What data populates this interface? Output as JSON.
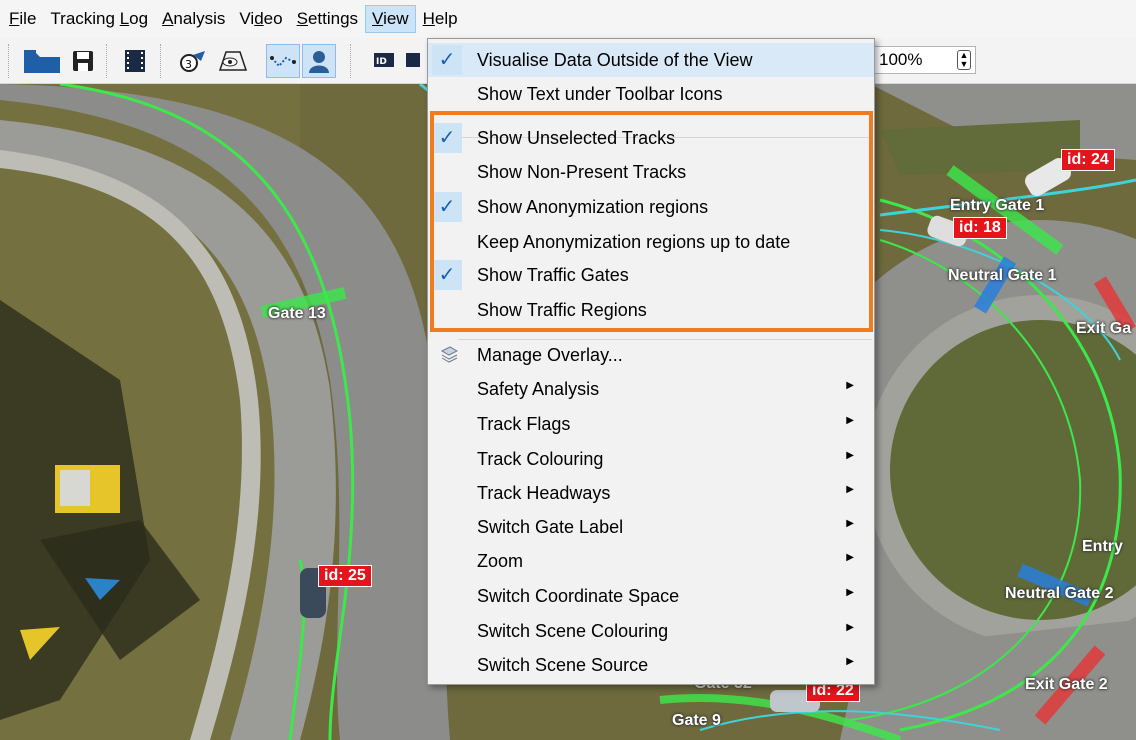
{
  "menubar": {
    "items": [
      {
        "pre": "",
        "acc": "F",
        "post": "ile"
      },
      {
        "pre": "Tracking ",
        "acc": "L",
        "post": "og"
      },
      {
        "pre": "",
        "acc": "A",
        "post": "nalysis"
      },
      {
        "pre": "Vi",
        "acc": "d",
        "post": "eo"
      },
      {
        "pre": "",
        "acc": "S",
        "post": "ettings"
      },
      {
        "pre": "",
        "acc": "V",
        "post": "iew"
      },
      {
        "pre": "",
        "acc": "H",
        "post": "elp"
      }
    ]
  },
  "toolbar": {
    "zoom_value": "100%",
    "icons": [
      "folder-icon",
      "save-icon",
      "film-icon",
      "timer-pointer-icon",
      "eye-region-icon",
      "track-points-icon",
      "person-icon",
      "id-label-icon"
    ]
  },
  "view_menu": {
    "items": [
      {
        "label": "Visualise Data Outside of the View",
        "checked": true
      },
      {
        "label": "Show Text under Toolbar Icons",
        "checked": false
      },
      {
        "label": "Show Unselected Tracks",
        "checked": true
      },
      {
        "label": "Show Non-Present Tracks",
        "checked": false
      },
      {
        "label": "Show Anonymization regions",
        "checked": true
      },
      {
        "label": "Keep Anonymization regions up to date",
        "checked": false
      },
      {
        "label": "Show Traffic Gates",
        "checked": true
      },
      {
        "label": "Show Traffic Regions",
        "checked": false
      },
      {
        "label": "Manage Overlay...",
        "icon": "layers-icon"
      },
      {
        "label": "Safety Analysis",
        "submenu": true
      },
      {
        "label": "Track Flags",
        "submenu": true
      },
      {
        "label": "Track Colouring",
        "submenu": true
      },
      {
        "label": "Track Headways",
        "submenu": true
      },
      {
        "label": "Switch Gate Label",
        "submenu": true
      },
      {
        "label": "Zoom",
        "submenu": true
      },
      {
        "label": "Switch Coordinate Space",
        "submenu": true
      },
      {
        "label": "Switch Scene Colouring",
        "submenu": true
      },
      {
        "label": "Switch Scene Source",
        "submenu": true
      }
    ],
    "check_glyph": "✓",
    "submenu_glyph": "▶"
  },
  "scene": {
    "track_ids": [
      "id: 24",
      "id: 18",
      "id: 25",
      "id: 22"
    ],
    "gates": [
      "Gate 13",
      "Entry Gate 1",
      "Neutral Gate 1",
      "Exit Ga",
      "Entry",
      "Neutral Gate 2",
      "Exit Gate 2",
      "Gate 9",
      "Gate 32"
    ]
  },
  "colors": {
    "highlight_border": "#f07c22",
    "check_bg": "#cde4f7",
    "id_label_bg": "#e3141b",
    "track_green": "#3ce84a",
    "track_cyan": "#3fd3d8",
    "gate_blue": "#2a7fdc",
    "gate_red": "#e23a3a"
  }
}
